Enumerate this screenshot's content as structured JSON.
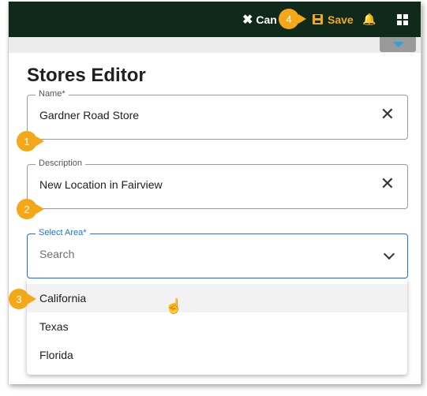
{
  "topbar": {
    "cancel_label": "Can",
    "save_label": "Save"
  },
  "editor": {
    "title": "Stores Editor"
  },
  "fields": {
    "name": {
      "label": "Name*",
      "value": "Gardner Road Store"
    },
    "description": {
      "label": "Description",
      "value": "New Location in Fairview"
    },
    "area": {
      "label": "Select Area*",
      "placeholder": "Search"
    }
  },
  "area_options": [
    "California",
    "Texas",
    "Florida"
  ],
  "callouts": [
    "1",
    "2",
    "3",
    "4"
  ],
  "colors": {
    "topbar_bg": "#0f2a1b",
    "accent": "#f4a817",
    "focus_blue": "#1976d2"
  },
  "icons": {
    "cancel": "close-icon",
    "save": "save-disk-icon",
    "notifications": "bell-icon",
    "apps": "apps-grid-icon",
    "clear": "clear-icon",
    "dropdown": "chevron-down-icon"
  }
}
